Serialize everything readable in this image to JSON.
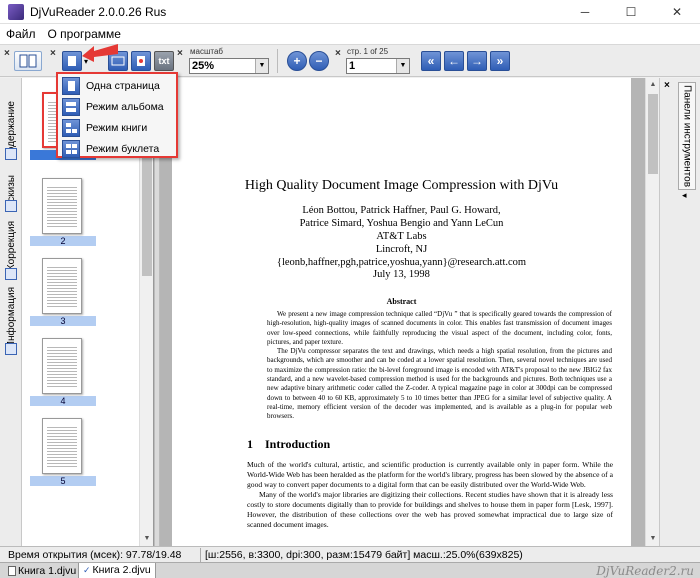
{
  "window": {
    "title": "DjVuReader 2.0.0.26 Rus",
    "minimize": "─",
    "maximize": "☐",
    "close": "✕"
  },
  "menu": {
    "items": [
      "Файл",
      "О программе"
    ]
  },
  "toolbar": {
    "zoom_label": "масштаб",
    "zoom_value": "25%",
    "page_label": "стр. 1 of 25",
    "page_value": "1",
    "txt_label": "txt",
    "close_marks": [
      "×",
      "×",
      "×",
      "×",
      "×"
    ]
  },
  "view_mode_menu": {
    "items": [
      "Одна страница",
      "Режим альбома",
      "Режим книги",
      "Режим буклета"
    ]
  },
  "left_tabs": [
    "Содержание",
    "Эскизы",
    "Коррекция",
    "Информация"
  ],
  "thumbnails": [
    "1",
    "2",
    "3",
    "4",
    "5"
  ],
  "right_panel": {
    "tab_label": "Панели инструментов",
    "arrow": "◂"
  },
  "document": {
    "title": "High Quality Document Image Compression with DjVu",
    "authors": [
      "Léon Bottou, Patrick Haffner, Paul G. Howard,",
      "Patrice Simard, Yoshua Bengio and Yann LeCun",
      "AT&T Labs",
      "Lincroft, NJ",
      "{leonb,haffner,pgh,patrice,yoshua,yann}@research.att.com"
    ],
    "date": "July 13, 1998",
    "abstract_heading": "Abstract",
    "abstract": [
      "We present a new image compression technique called “DjVu ” that is specifically geared towards the compression of high-resolution, high-quality images of scanned documents in color. This enables fast transmission of document images over low-speed connections, while faithfully reproducing the visual aspect of the document, including color, fonts, pictures, and paper texture.",
      "The DjVu compressor separates the text and drawings, which needs a high spatial resolution, from the pictures and backgrounds, which are smoother and can be coded at a lower spatial resolution. Then, several novel techniques are used to maximize the compression ratio: the bi-level foreground image is encoded with AT&T's proposal to the new JBIG2 fax standard, and a new wavelet-based compression method is used for the backgrounds and pictures. Both techniques use a new adaptive binary arithmetic coder called the Z-coder. A typical magazine page in color at 300dpi can be compressed down to between 40 to 60 KB, approximately 5 to 10 times better than JPEG for a similar level of subjective quality. A real-time, memory efficient version of the decoder was implemented, and is available as a plug-in for popular web browsers."
    ],
    "section_number": "1",
    "section_title": "Introduction",
    "body": [
      "Much of the world's cultural, artistic, and scientific production is currently available only in paper form. While the World-Wide Web has been heralded as the platform for the world's library, progress has been slowed by the absence of a good way to convert paper documents to a digital form that can be easily distributed over the World-Wide Web.",
      "Many of the world's major libraries are digitizing their collections. Recent studies have shown that it is already less costly to store documents digitally than to provide for buildings and shelves to house them in paper form [Lesk, 1997]. However, the distribution of these collections over the web has proved somewhat impractical due to large size of scanned document images."
    ]
  },
  "status": {
    "open_time": "Время открытия (мсек): 97.78/19.48",
    "info": "[ш:2556, в:3300, dpi:300, разм:15479 байт] масш.:25.0%(639x825)"
  },
  "tabs": [
    "Книга 1.djvu",
    "Книга 2.djvu"
  ],
  "watermark": "DjVuReader2.ru",
  "colors": {
    "highlight": "#e53935",
    "accent": "#2f5db5",
    "thumb_label": "#b3cdf2"
  }
}
